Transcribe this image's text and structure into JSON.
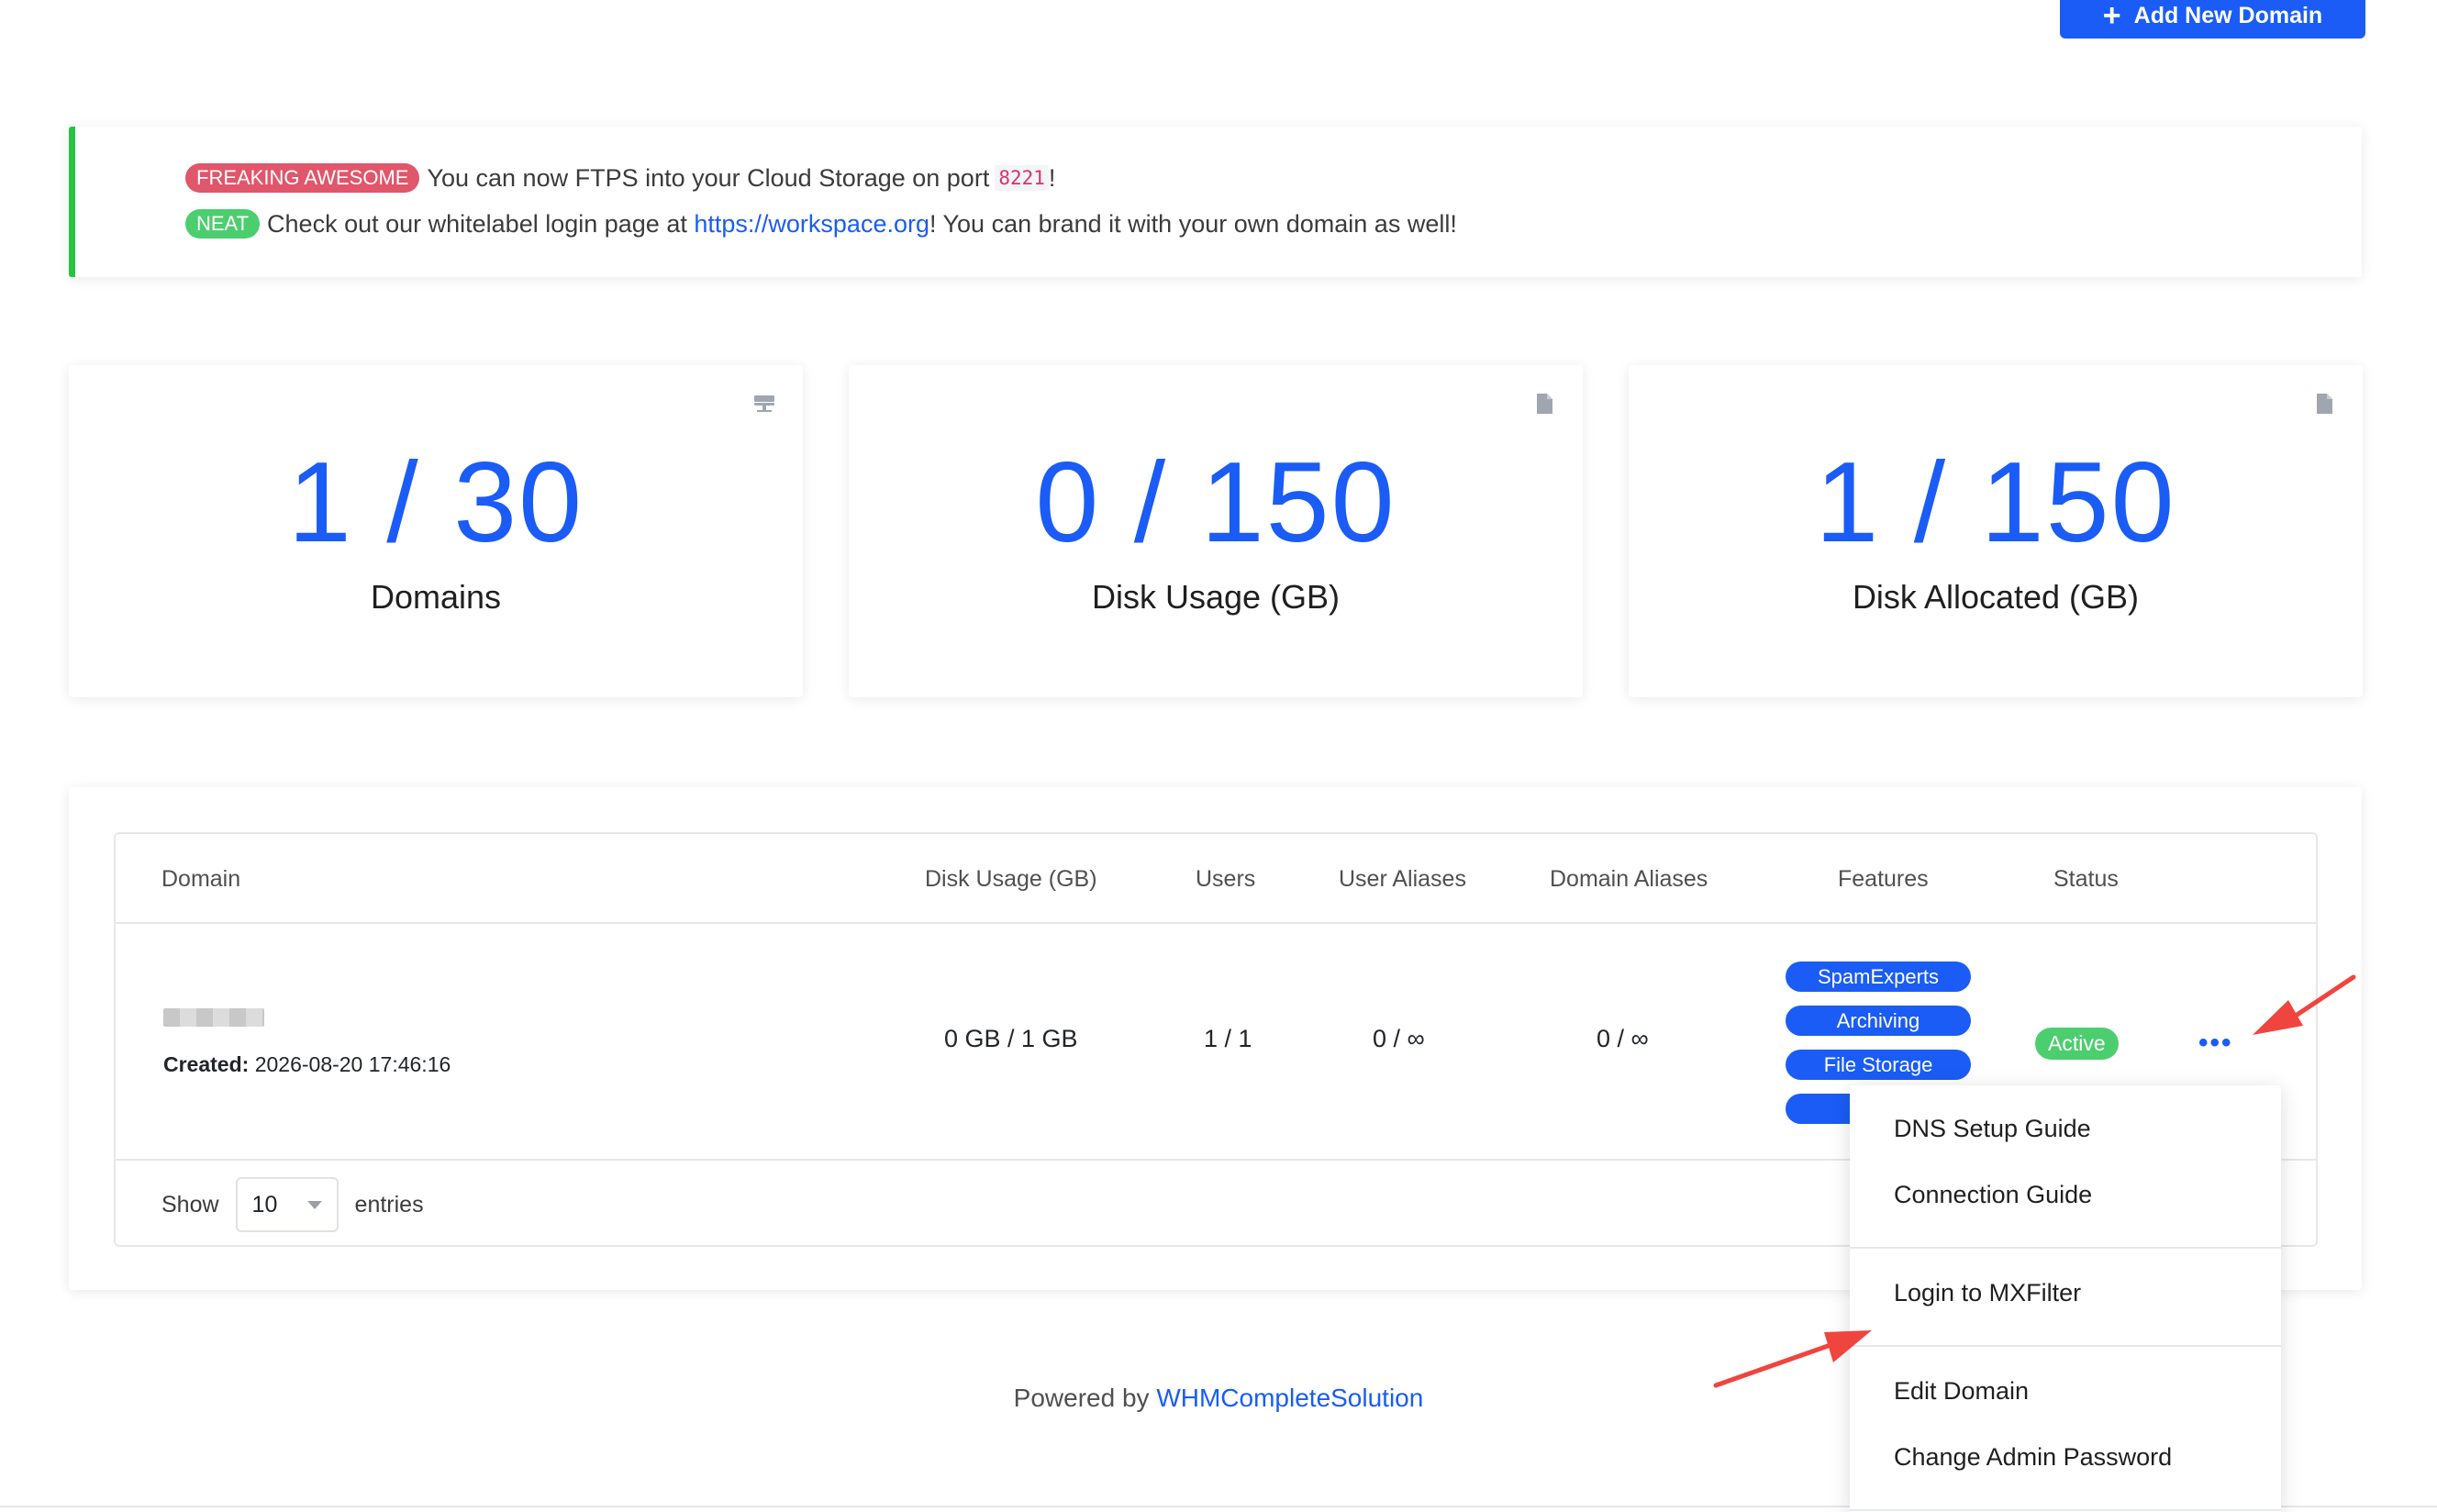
{
  "header": {
    "add_domain_label": "Add New Domain"
  },
  "announcements": [
    {
      "badge": "FREAKING AWESOME",
      "text": "You can now FTPS into your Cloud Storage on port",
      "code": "8221",
      "suffix": "!"
    },
    {
      "badge": "NEAT",
      "text": "Check out our whitelabel login page at",
      "link": "https://workspace.org",
      "suffix": "! You can brand it with your own domain as well!"
    }
  ],
  "stats": [
    {
      "value": "1 / 30",
      "label": "Domains",
      "icon": "server-icon"
    },
    {
      "value": "0 / 150",
      "label": "Disk Usage (GB)",
      "icon": "document-icon"
    },
    {
      "value": "1 / 150",
      "label": "Disk Allocated (GB)",
      "icon": "document-icon"
    }
  ],
  "table": {
    "columns": [
      "Domain",
      "Disk Usage (GB)",
      "Users",
      "User Aliases",
      "Domain Aliases",
      "Features",
      "Status"
    ],
    "rows": [
      {
        "created_label": "Created:",
        "created": "2026-08-20 17:46:16",
        "disk": "0 GB / 1 GB",
        "users": "1 / 1",
        "user_aliases": "0 / ∞",
        "domain_aliases": "0 / ∞",
        "features": [
          "SpamExperts",
          "Archiving",
          "File Storage",
          ""
        ],
        "status": "Active",
        "actions_label": "•••"
      }
    ],
    "show_label": "Show",
    "page_size": "10",
    "entries_label": "entries"
  },
  "dropdown": {
    "items": [
      "DNS Setup Guide",
      "Connection Guide",
      "Login to MXFilter",
      "Edit Domain",
      "Change Admin Password"
    ]
  },
  "footer": {
    "powered_by": "Powered by",
    "link": "WHMCompleteSolution"
  },
  "colors": {
    "primary": "#1a5cf5",
    "success": "#4cce6e",
    "danger": "#e0566a",
    "annotation": "#f0453f"
  }
}
